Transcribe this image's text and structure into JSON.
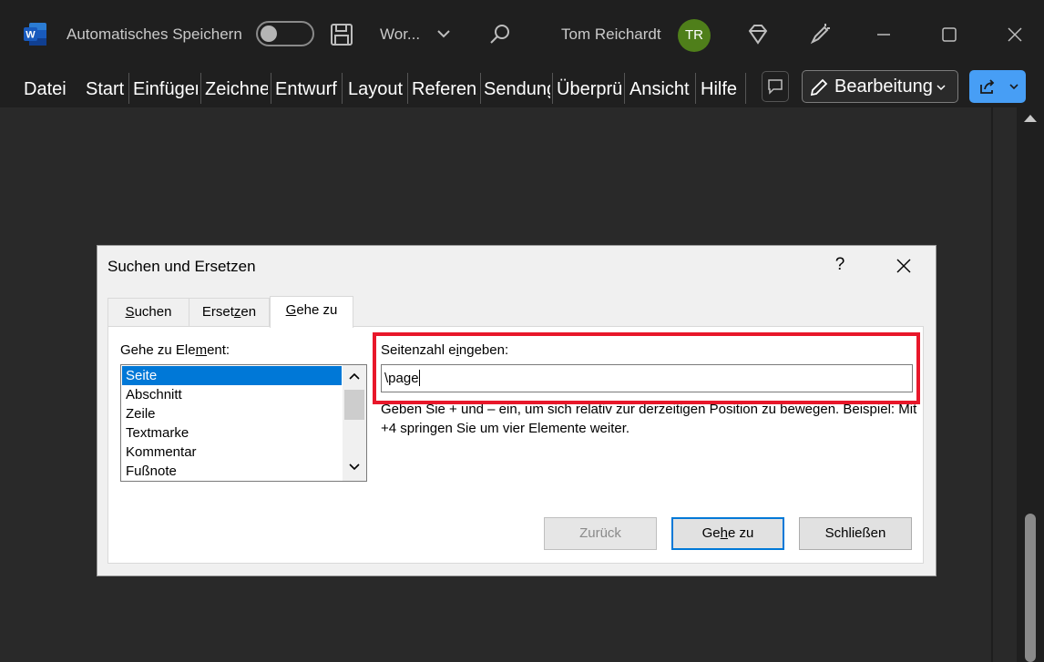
{
  "titlebar": {
    "autosave_label": "Automatisches Speichern",
    "doc_name": "Wor...",
    "user_name": "Tom Reichardt",
    "user_initials": "TR"
  },
  "ribbon": {
    "tabs": [
      "Datei",
      "Start",
      "Einfügen",
      "Zeichnen",
      "Entwurf",
      "Layout",
      "Referenzen",
      "Sendungen",
      "Überprüfen",
      "Ansicht",
      "Hilfe"
    ],
    "mode_label": "Bearbeitung"
  },
  "dialog": {
    "title": "Suchen und Ersetzen",
    "help": "?",
    "tabs": {
      "search": {
        "pre": "",
        "u": "S",
        "post": "uchen"
      },
      "replace": {
        "pre": "Erset",
        "u": "z",
        "post": "en"
      },
      "goto": {
        "pre": "",
        "u": "G",
        "post": "ehe zu"
      }
    },
    "element_label": {
      "pre": "Gehe zu Ele",
      "u": "m",
      "post": "ent:"
    },
    "elements": [
      "Seite",
      "Abschnitt",
      "Zeile",
      "Textmarke",
      "Kommentar",
      "Fußnote"
    ],
    "selected_element": "Seite",
    "input_label": {
      "pre": "Seitenzahl e",
      "u": "i",
      "post": "ngeben:"
    },
    "input_value": "\\page",
    "hint": "Geben Sie + und – ein, um sich relativ zur derzeitigen Position zu bewegen. Beispiel: Mit +4 springen Sie um vier Elemente weiter.",
    "buttons": {
      "back": "Zurück",
      "goto": {
        "pre": "Ge",
        "u": "h",
        "post": "e zu"
      },
      "close": "Schließen"
    }
  },
  "colors": {
    "highlight_box": "#e8172a",
    "selection": "#0078d7",
    "avatar": "#4f7f1a",
    "share": "#479ef5"
  }
}
